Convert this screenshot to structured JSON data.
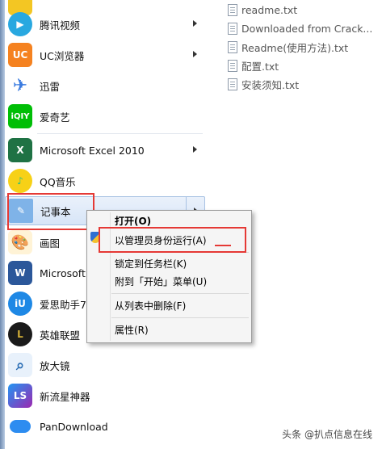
{
  "start_menu": {
    "items": [
      {
        "label": "",
        "icon": "folder-icon",
        "color": "#f3c623",
        "has_submenu": false
      },
      {
        "label": "腾讯视频",
        "icon": "tencent-video-icon",
        "color": "#29a8e0",
        "has_submenu": true
      },
      {
        "label": "UC浏览器",
        "icon": "uc-browser-icon",
        "color": "#f58220",
        "has_submenu": true
      },
      {
        "label": "迅雷",
        "icon": "xunlei-icon",
        "color": "#3a7be0",
        "has_submenu": false
      },
      {
        "label": "爱奇艺",
        "icon": "iqiyi-icon",
        "color": "#00be06",
        "has_submenu": false
      },
      {
        "label": "Microsoft Excel 2010",
        "icon": "excel-icon",
        "color": "#1f7244",
        "has_submenu": true
      },
      {
        "label": "QQ音乐",
        "icon": "qq-music-icon",
        "color": "#31c27c",
        "has_submenu": false
      },
      {
        "label": "记事本",
        "icon": "notepad-icon",
        "color": "#7fb3e8",
        "has_submenu": true
      },
      {
        "label": "画图",
        "icon": "paint-icon",
        "color": "#f0a030",
        "has_submenu": false
      },
      {
        "label": "Microsoft",
        "icon": "word-icon",
        "color": "#2b579a",
        "has_submenu": false
      },
      {
        "label": "爱思助手7.",
        "icon": "i4-icon",
        "color": "#1e88e5",
        "has_submenu": false
      },
      {
        "label": "英雄联盟",
        "icon": "lol-icon",
        "color": "#b8902f",
        "has_submenu": false
      },
      {
        "label": "放大镜",
        "icon": "magnifier-icon",
        "color": "#4a90d9",
        "has_submenu": false
      },
      {
        "label": "新流星神器",
        "icon": "meteor-icon",
        "color": "#8e44ad",
        "has_submenu": false
      },
      {
        "label": "PanDownload",
        "icon": "pandownload-icon",
        "color": "#2d8cf0",
        "has_submenu": false
      }
    ]
  },
  "files": [
    "readme.txt",
    "Downloaded from Crack...",
    "Readme(使用方法).txt",
    "配置.txt",
    "安装须知.txt"
  ],
  "context_menu": {
    "open": "打开(O)",
    "run_as_admin": "以管理员身份运行(A)",
    "pin_taskbar": "锁定到任务栏(K)",
    "pin_start": "附到「开始」菜单(U)",
    "remove_list": "从列表中删除(F)",
    "properties": "属性(R)"
  },
  "watermark": "头条 @扒点信息在线",
  "colors": {
    "highlight": "#e53935",
    "selection_border": "#a8c2e3"
  }
}
